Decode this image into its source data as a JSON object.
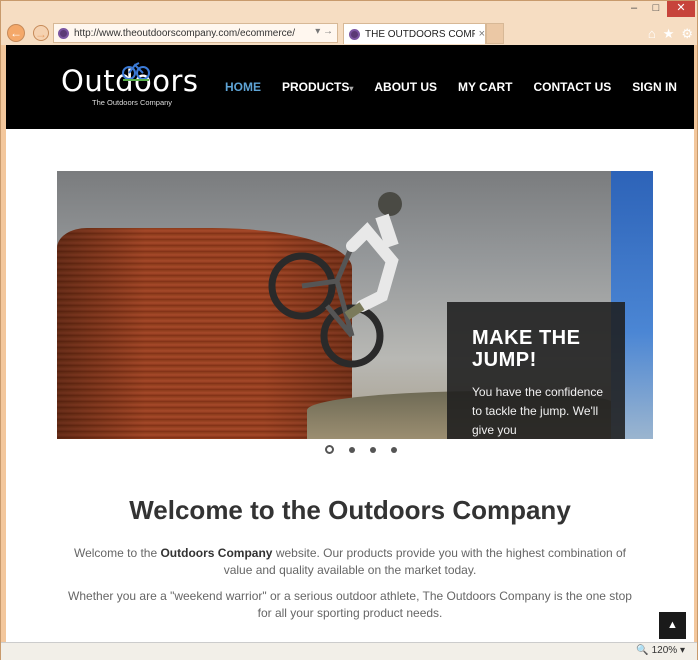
{
  "browser": {
    "address": "http://www.theoutdoorscompany.com/ecommerce/",
    "tab_title": "THE OUTDOORS COMPAN...",
    "tab_close": "×",
    "addr_tools": "▾ →",
    "zoom": "120%"
  },
  "site": {
    "logo_text": "Outdoors",
    "logo_sub": "The Outdoors Company",
    "nav": {
      "home": "HOME",
      "products": "PRODUCTS",
      "about": "ABOUT US",
      "cart": "MY CART",
      "contact": "CONTACT US",
      "signin": "SIGN IN"
    }
  },
  "carousel": {
    "title_line1": "MAKE THE",
    "title_line2": "JUMP!",
    "text": "You have the confidence to tackle the jump. We'll give you",
    "slide_count": 4,
    "active_slide": 1
  },
  "welcome": {
    "title": "Welcome to the Outdoors Company",
    "p1_before": "Welcome to the ",
    "p1_bold": "Outdoors Company",
    "p1_after": " website. Our products provide you with the highest combination of value and quality available on the market today.",
    "p2": "Whether you are a \"weekend warrior\" or a serious outdoor athlete, The Outdoors Company is the one stop for all your sporting product needs."
  },
  "colors": {
    "nav_active": "#5ea4d6",
    "header_bg": "#000000",
    "chrome_bg": "#f6ddc2"
  }
}
